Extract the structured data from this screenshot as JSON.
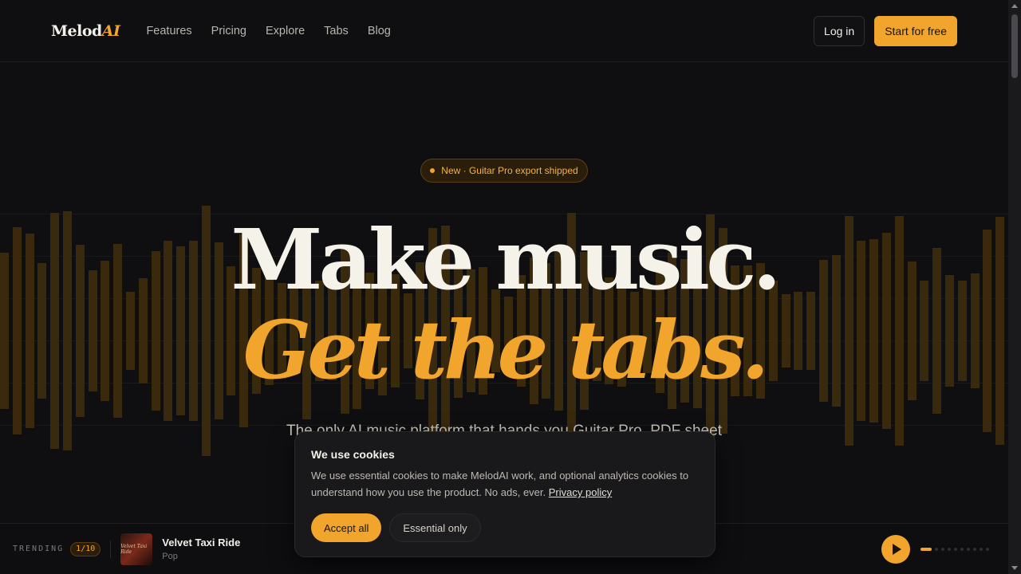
{
  "nav": {
    "logo_main": "Melod",
    "logo_accent": "AI",
    "links": [
      "Features",
      "Pricing",
      "Explore",
      "Tabs",
      "Blog"
    ],
    "login": "Log in",
    "start": "Start for free"
  },
  "hero": {
    "badge": "New · Guitar Pro export shipped",
    "line1": "Make music.",
    "line2": "Get the tabs.",
    "subtext": "The only AI music platform that hands you Guitar Pro, PDF sheet"
  },
  "trending": {
    "label": "TRENDING",
    "count": "1/10",
    "cover_text": "Velvet Taxi Ride",
    "title": "Velvet Taxi Ride",
    "genre": "Pop",
    "active_index": 0,
    "total": 10
  },
  "cookie": {
    "title": "We use cookies",
    "text": "We use essential cookies to make MelodAI work, and optional analytics cookies to understand how you use the product. No ads, ever.",
    "link": "Privacy policy",
    "accept": "Accept all",
    "essential": "Essential only"
  },
  "colors": {
    "accent": "#f2a52c",
    "background": "#0f0f11"
  }
}
